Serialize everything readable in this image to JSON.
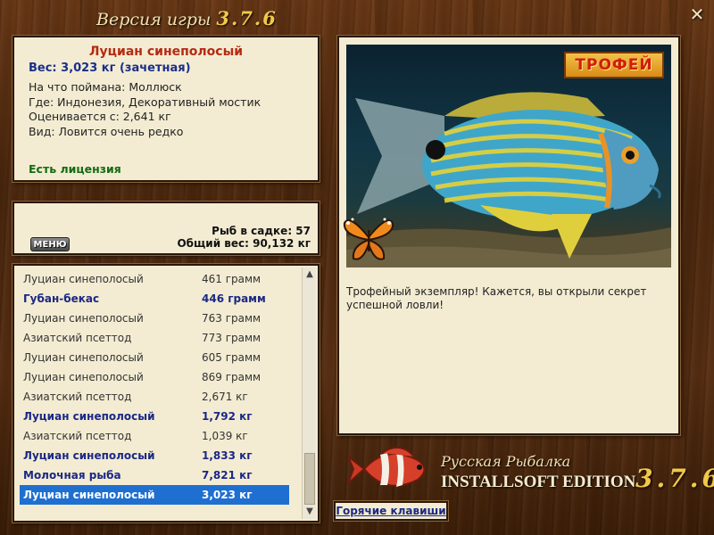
{
  "window": {
    "title_prefix": "Версия игры",
    "version": "3.7.6",
    "close_glyph": "✕"
  },
  "info": {
    "fish_name": "Луциан синеполосый",
    "weight": "Вес: 3,023 кг (зачетная)",
    "bait": "На что поймана: Моллюск",
    "location": "Где: Индонезия, Декоративный мостик",
    "rating": "Оценивается с: 2,641 кг",
    "rarity": "Вид: Ловится очень редко",
    "license": "Есть лицензия"
  },
  "stats": {
    "fish_in_keepnet": "Рыб в садке: 57",
    "total_weight": "Общий вес: 90,132 кг",
    "menu_label": "МЕНЮ"
  },
  "catch_list": [
    {
      "name": "Луциан синеполосый",
      "weight": "461 грамм",
      "bold": false,
      "selected": false
    },
    {
      "name": "Губан-бекас",
      "weight": "446 грамм",
      "bold": true,
      "selected": false
    },
    {
      "name": "Луциан синеполосый",
      "weight": "763 грамм",
      "bold": false,
      "selected": false
    },
    {
      "name": "Азиатский псеттод",
      "weight": "773 грамм",
      "bold": false,
      "selected": false
    },
    {
      "name": "Луциан синеполосый",
      "weight": "605 грамм",
      "bold": false,
      "selected": false
    },
    {
      "name": "Луциан синеполосый",
      "weight": "869 грамм",
      "bold": false,
      "selected": false
    },
    {
      "name": "Азиатский псеттод",
      "weight": "2,671 кг",
      "bold": false,
      "selected": false
    },
    {
      "name": "Луциан синеполосый",
      "weight": "1,792 кг",
      "bold": true,
      "selected": false
    },
    {
      "name": "Азиатский псеттод",
      "weight": "1,039 кг",
      "bold": false,
      "selected": false
    },
    {
      "name": "Луциан синеполосый",
      "weight": "1,833 кг",
      "bold": true,
      "selected": false
    },
    {
      "name": "Молочная рыба",
      "weight": "7,821 кг",
      "bold": true,
      "selected": false
    },
    {
      "name": "Луциан синеполосый",
      "weight": "3,023 кг",
      "bold": true,
      "selected": true
    }
  ],
  "trophy": {
    "badge": "ТРОФЕЙ",
    "description": "Трофейный экземпляр! Кажется, вы открыли секрет успешной ловли!"
  },
  "logo": {
    "title": "Русская Рыбалка",
    "edition": "INSTALLSOFT EDITION",
    "version": "3.7.6"
  },
  "hotkeys_label": "Горячие клавиши",
  "colors": {
    "panel_bg": "#f3ecd2",
    "fish_name": "#b52a12",
    "weight_text": "#1b2f8a",
    "license_text": "#136b13",
    "selection": "#1f6fd0",
    "trophy_badge": "#e8a828"
  },
  "icons": [
    "close-icon",
    "butterfly-icon",
    "fish-logo-icon",
    "scroll-up-icon",
    "scroll-down-icon"
  ]
}
